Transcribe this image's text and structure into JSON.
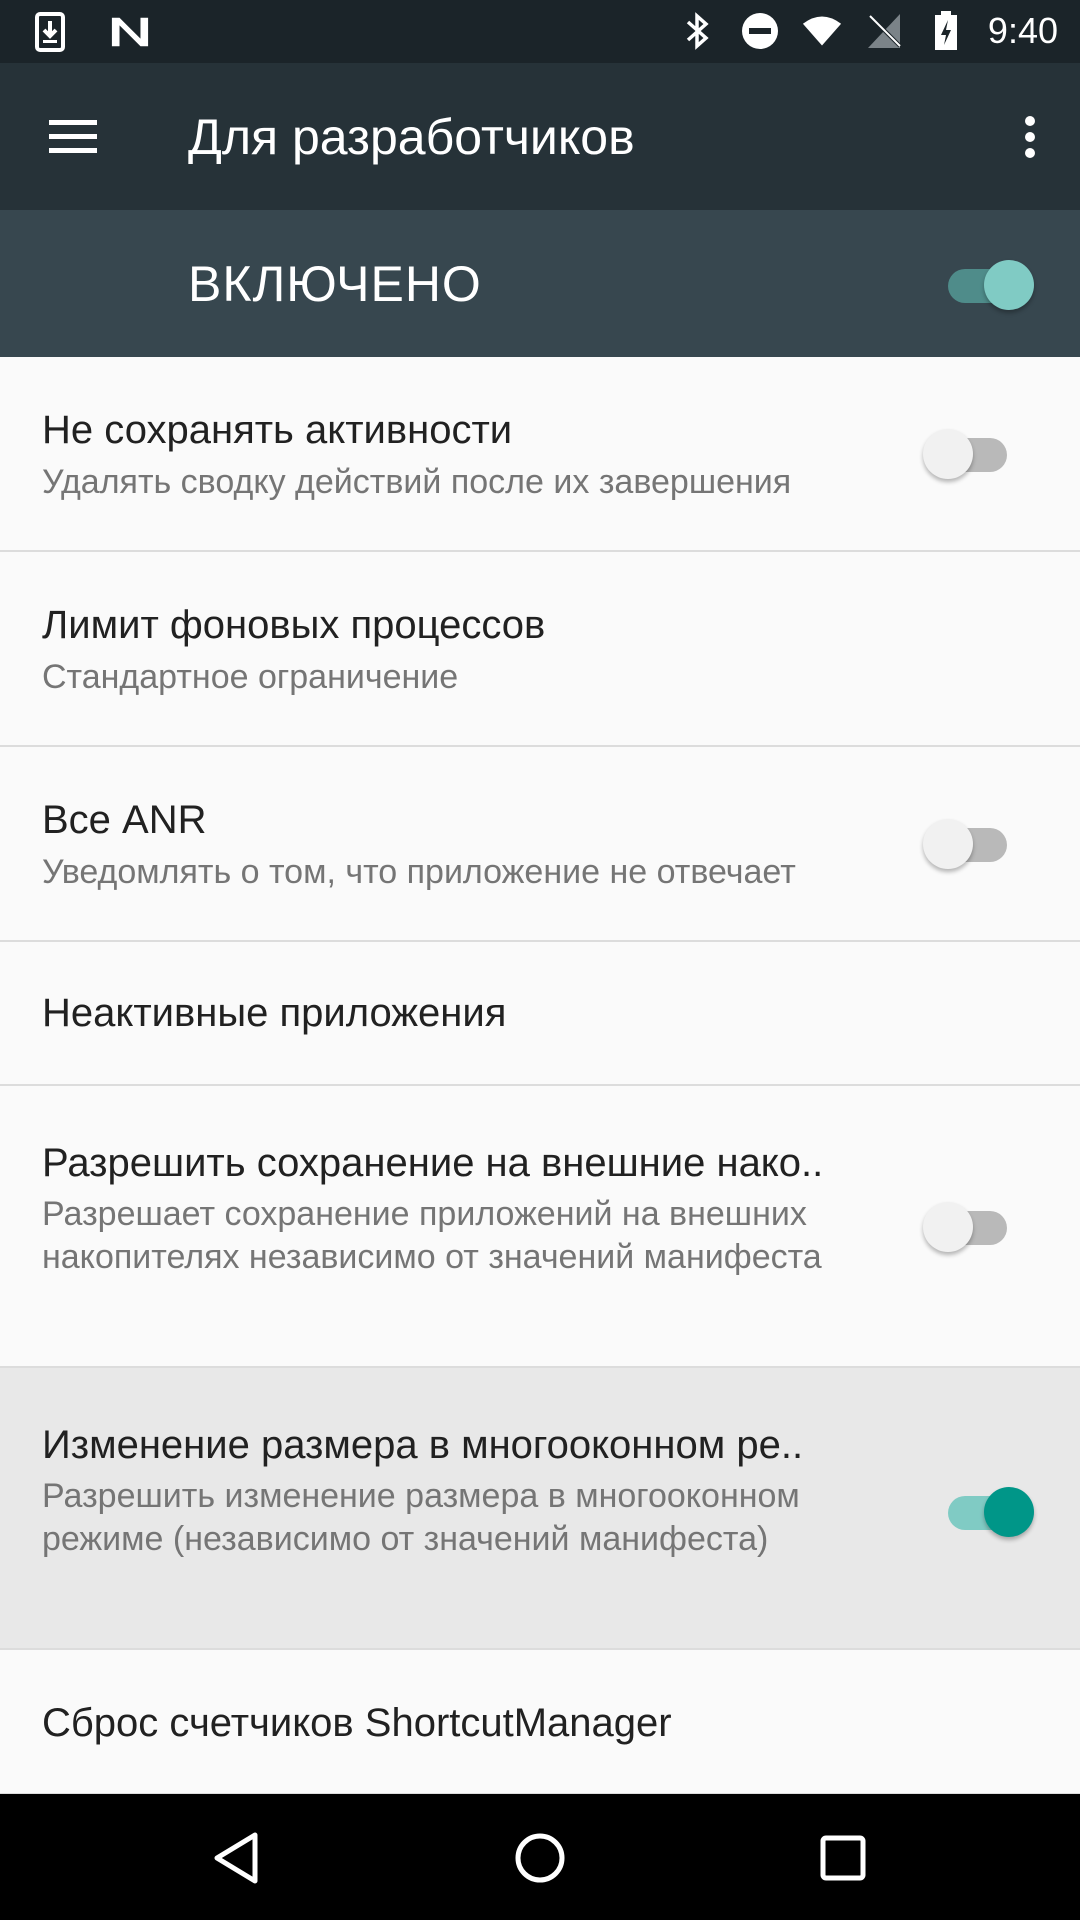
{
  "status_bar": {
    "time": "9:40",
    "left_icons": [
      "download-icon",
      "n-logo-icon"
    ],
    "right_icons": [
      "bluetooth-icon",
      "do-not-disturb-icon",
      "wifi-icon",
      "no-sim-icon",
      "battery-charging-icon"
    ]
  },
  "app_bar": {
    "title": "Для разработчиков",
    "menu_icon": "hamburger-menu-icon",
    "more_icon": "more-vert-icon"
  },
  "master_switch": {
    "label": "ВКЛЮЧЕНО",
    "checked": true
  },
  "settings": [
    {
      "title": "Не сохранять активности",
      "summary": "Удалять сводку действий после их завершения",
      "switch": false
    },
    {
      "title": "Лимит фоновых процессов",
      "summary": "Стандартное ограничение"
    },
    {
      "title": "Все ANR",
      "summary": "Уведомлять о том, что приложение не отвечает",
      "switch": false
    },
    {
      "title": "Неактивные приложения"
    },
    {
      "title": "Разрешить сохранение на внешние нако..",
      "summary": "Разрешает сохранение приложений на внешних накопителях независимо от значений манифеста",
      "switch": false
    },
    {
      "title": "Изменение размера в многооконном ре..",
      "summary": "Разрешить изменение размера в многооконном режиме (независимо от значений манифеста)",
      "switch": true,
      "highlighted": true
    },
    {
      "title": "Сброс счетчиков ShortcutManager"
    }
  ],
  "nav_bar": {
    "buttons": [
      "back-icon",
      "home-icon",
      "recents-icon"
    ]
  },
  "colors": {
    "status_bar": "#1b2429",
    "app_bar": "#263238",
    "master_bar": "#37474f",
    "accent": "#009688",
    "accent_light": "#80cbc4"
  }
}
